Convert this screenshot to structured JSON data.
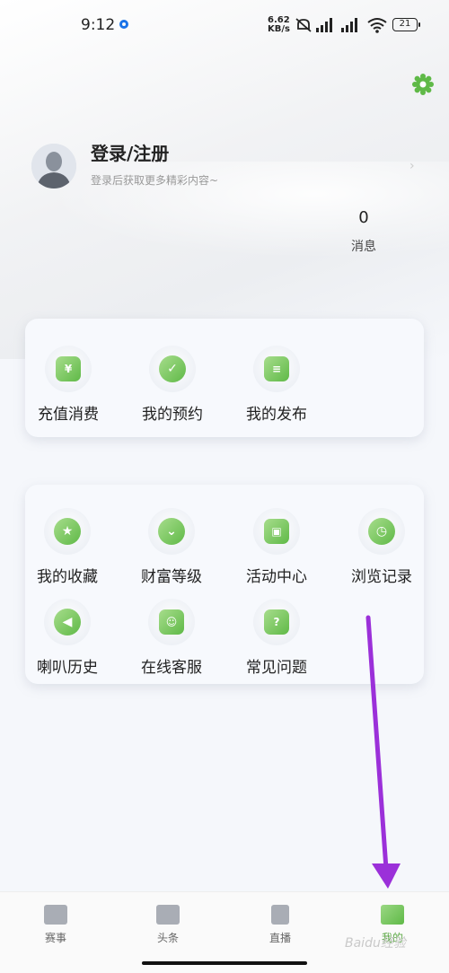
{
  "status_bar": {
    "time": "9:12",
    "net_speed": "6.62",
    "net_unit": "KB/s",
    "icons": "🔕 ▮▮ HD ▮▮ 📶",
    "battery": "21"
  },
  "profile": {
    "login_title": "登录/注册",
    "login_subtitle": "登录后获取更多精彩内容~",
    "message_count": "0",
    "message_label": "消息"
  },
  "quick_actions": [
    {
      "label": "充值消费",
      "icon": "recharge-icon",
      "glyph": "¥"
    },
    {
      "label": "我的预约",
      "icon": "reservation-icon",
      "glyph": "✓"
    },
    {
      "label": "我的发布",
      "icon": "publish-icon",
      "glyph": "≡"
    }
  ],
  "services": [
    {
      "label": "我的收藏",
      "icon": "star-icon",
      "glyph": "★"
    },
    {
      "label": "财富等级",
      "icon": "diamond-icon",
      "glyph": "⌄"
    },
    {
      "label": "活动中心",
      "icon": "gift-icon",
      "glyph": "▣"
    },
    {
      "label": "浏览记录",
      "icon": "clock-icon",
      "glyph": "◷"
    },
    {
      "label": "喇叭历史",
      "icon": "megaphone-icon",
      "glyph": "◀"
    },
    {
      "label": "在线客服",
      "icon": "smile-icon",
      "glyph": "☺"
    },
    {
      "label": "常见问题",
      "icon": "question-icon",
      "glyph": "?"
    }
  ],
  "bottom_nav": [
    {
      "label": "赛事",
      "icon": "match-icon"
    },
    {
      "label": "头条",
      "icon": "headline-icon"
    },
    {
      "label": "直播",
      "icon": "live-icon"
    },
    {
      "label": "我的",
      "icon": "me-icon",
      "active": true
    }
  ],
  "watermark": "Baidu经验",
  "colors": {
    "accent": "#5fb947",
    "arrow": "#9b30d9"
  }
}
